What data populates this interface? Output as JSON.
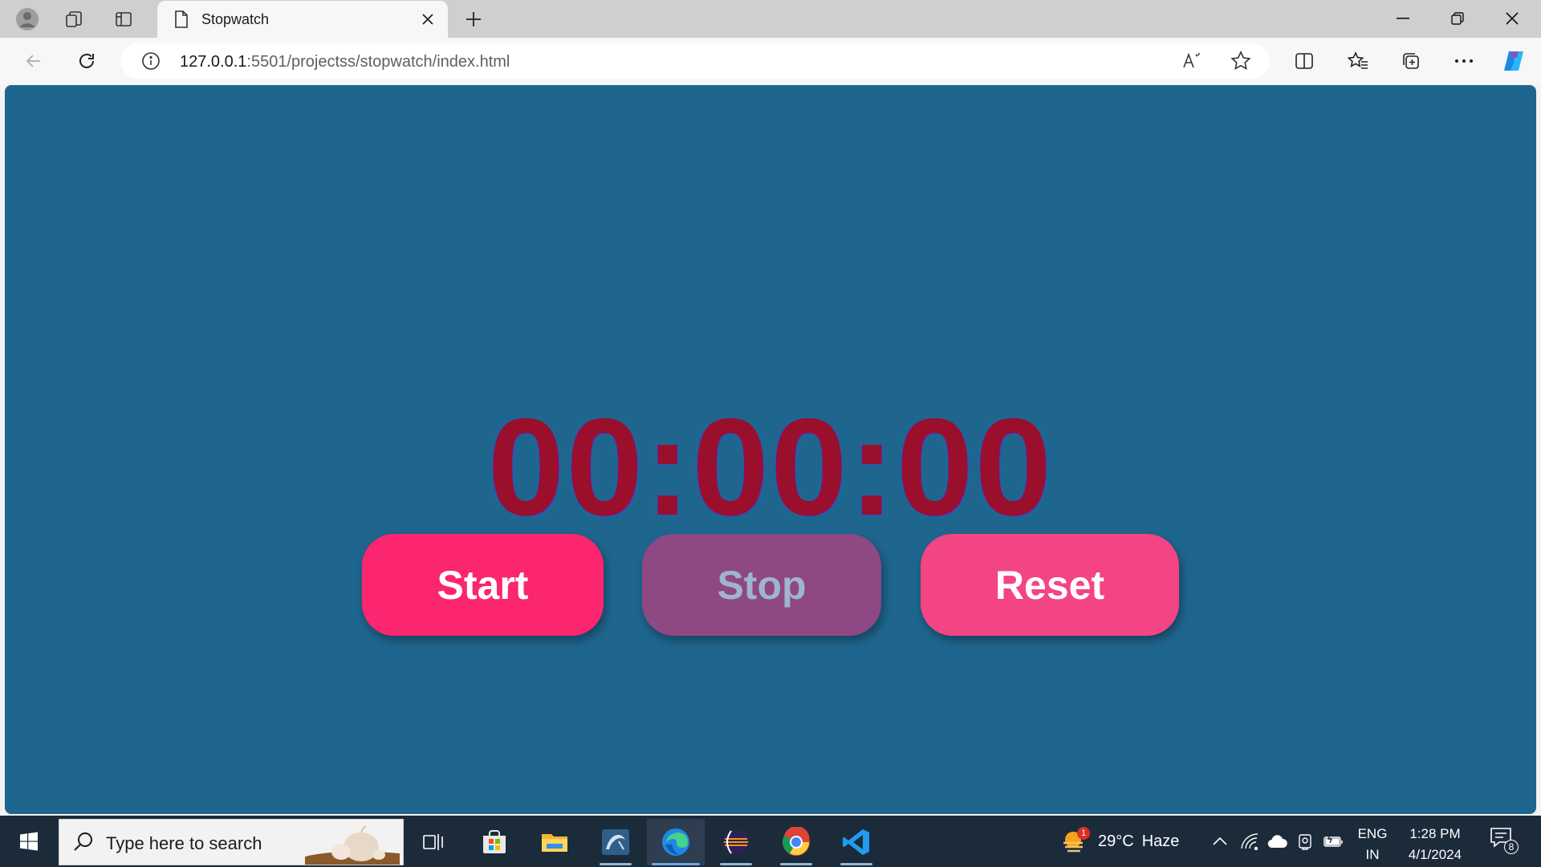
{
  "browser": {
    "tab": {
      "title": "Stopwatch",
      "icon": "page-icon"
    },
    "address": {
      "host": "127.0.0.1",
      "path": ":5501/projectss/stopwatch/index.html"
    }
  },
  "page": {
    "timer": {
      "hours": "00",
      "minutes": "00",
      "seconds": "00",
      "separator": ":"
    },
    "buttons": {
      "start": "Start",
      "stop": "Stop",
      "reset": "Reset"
    }
  },
  "colors": {
    "page_background": "#1f668f",
    "timer_text": "#990f2c",
    "start_button": "#fb2570",
    "stop_button": "#8e4883",
    "reset_button": "#f34483"
  },
  "taskbar": {
    "search_placeholder": "Type here to search",
    "apps": [
      "task-view-icon",
      "store-icon",
      "file-explorer-icon",
      "mysql-workbench-icon",
      "edge-icon",
      "eclipse-icon",
      "chrome-icon",
      "vscode-icon"
    ],
    "weather": {
      "temperature": "29°C",
      "condition": "Haze",
      "alert_count": "1"
    },
    "language": {
      "lang": "ENG",
      "region": "IN"
    },
    "clock": {
      "time": "1:28 PM",
      "date": "4/1/2024"
    },
    "notifications": {
      "count": "8"
    }
  }
}
